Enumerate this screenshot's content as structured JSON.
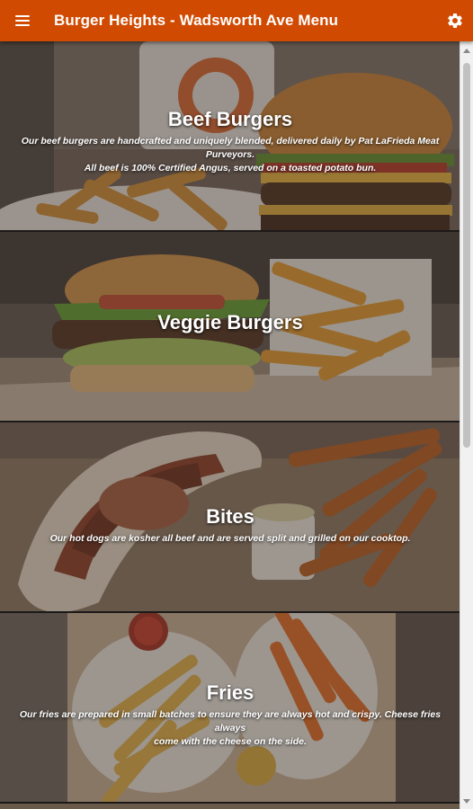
{
  "appbar": {
    "title": "Burger Heights - Wadsworth Ave Menu",
    "menu_icon": "hamburger-menu-icon",
    "settings_icon": "gear-icon",
    "color": "#d04a02"
  },
  "categories": [
    {
      "title": "Beef Burgers",
      "description": "Our beef burgers are handcrafted and uniquely blended, delivered daily by Pat LaFrieda Meat Purveyors.\nAll beef is 100% Certified Angus, served on a toasted potato bun."
    },
    {
      "title": "Veggie Burgers",
      "description": ""
    },
    {
      "title": "Bites",
      "description": "Our hot dogs are kosher all beef and are served split and grilled on our cooktop."
    },
    {
      "title": "Fries",
      "description": "Our fries are prepared in small batches to ensure they are always hot and crispy. Cheese fries always\ncome with the cheese on the side."
    }
  ]
}
